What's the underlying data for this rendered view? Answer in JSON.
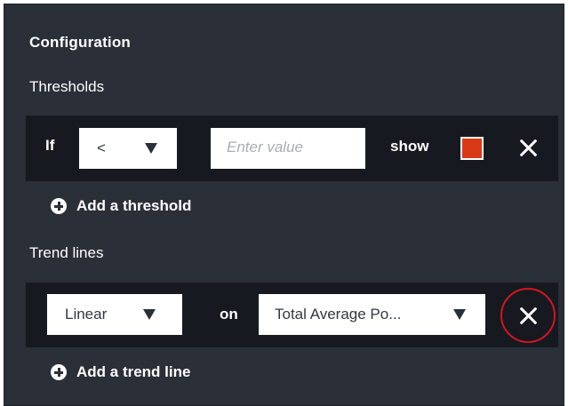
{
  "panel": {
    "title": "Configuration"
  },
  "thresholds": {
    "label": "Thresholds",
    "if_label": "If",
    "operator": "<",
    "value_placeholder": "Enter value",
    "show_label": "show",
    "swatch_color": "#d93a15",
    "add_label": "Add a threshold"
  },
  "trend_lines": {
    "label": "Trend lines",
    "type": "Linear",
    "on_label": "on",
    "field": "Total Average Po...",
    "add_label": "Add a trend line"
  },
  "colors": {
    "panel_bg": "#2a2f38",
    "row_bg": "#161a20",
    "highlight": "#d6151f"
  }
}
